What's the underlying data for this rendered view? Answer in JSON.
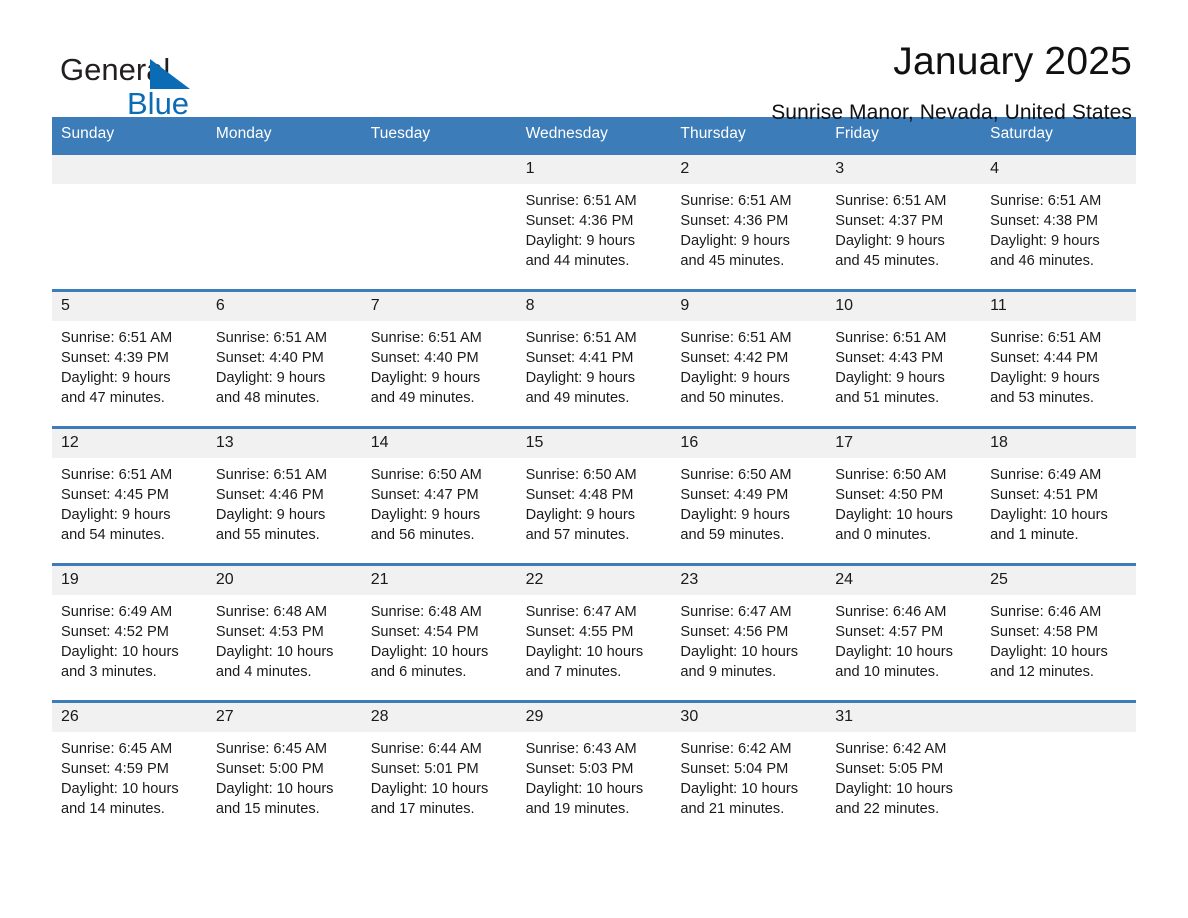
{
  "logo": {
    "word_one": "General",
    "word_two": "Blue",
    "triangle_color": "#0b6cb5",
    "text_color": "#231f20"
  },
  "header": {
    "month_title": "January 2025",
    "location": "Sunrise Manor, Nevada, United States"
  },
  "theme": {
    "header_blue": "#3c7cb8",
    "row_divider_blue": "#3c7cb8",
    "daynum_band": "#f1f1f1",
    "page_background": "#ffffff",
    "text": "#1a1a1a"
  },
  "calendar": {
    "weekdays": [
      "Sunday",
      "Monday",
      "Tuesday",
      "Wednesday",
      "Thursday",
      "Friday",
      "Saturday"
    ],
    "weeks": [
      [
        {
          "day": "",
          "sunrise": "",
          "sunset": "",
          "daylight_1": "",
          "daylight_2": ""
        },
        {
          "day": "",
          "sunrise": "",
          "sunset": "",
          "daylight_1": "",
          "daylight_2": ""
        },
        {
          "day": "",
          "sunrise": "",
          "sunset": "",
          "daylight_1": "",
          "daylight_2": ""
        },
        {
          "day": "1",
          "sunrise": "Sunrise: 6:51 AM",
          "sunset": "Sunset: 4:36 PM",
          "daylight_1": "Daylight: 9 hours",
          "daylight_2": "and 44 minutes."
        },
        {
          "day": "2",
          "sunrise": "Sunrise: 6:51 AM",
          "sunset": "Sunset: 4:36 PM",
          "daylight_1": "Daylight: 9 hours",
          "daylight_2": "and 45 minutes."
        },
        {
          "day": "3",
          "sunrise": "Sunrise: 6:51 AM",
          "sunset": "Sunset: 4:37 PM",
          "daylight_1": "Daylight: 9 hours",
          "daylight_2": "and 45 minutes."
        },
        {
          "day": "4",
          "sunrise": "Sunrise: 6:51 AM",
          "sunset": "Sunset: 4:38 PM",
          "daylight_1": "Daylight: 9 hours",
          "daylight_2": "and 46 minutes."
        }
      ],
      [
        {
          "day": "5",
          "sunrise": "Sunrise: 6:51 AM",
          "sunset": "Sunset: 4:39 PM",
          "daylight_1": "Daylight: 9 hours",
          "daylight_2": "and 47 minutes."
        },
        {
          "day": "6",
          "sunrise": "Sunrise: 6:51 AM",
          "sunset": "Sunset: 4:40 PM",
          "daylight_1": "Daylight: 9 hours",
          "daylight_2": "and 48 minutes."
        },
        {
          "day": "7",
          "sunrise": "Sunrise: 6:51 AM",
          "sunset": "Sunset: 4:40 PM",
          "daylight_1": "Daylight: 9 hours",
          "daylight_2": "and 49 minutes."
        },
        {
          "day": "8",
          "sunrise": "Sunrise: 6:51 AM",
          "sunset": "Sunset: 4:41 PM",
          "daylight_1": "Daylight: 9 hours",
          "daylight_2": "and 49 minutes."
        },
        {
          "day": "9",
          "sunrise": "Sunrise: 6:51 AM",
          "sunset": "Sunset: 4:42 PM",
          "daylight_1": "Daylight: 9 hours",
          "daylight_2": "and 50 minutes."
        },
        {
          "day": "10",
          "sunrise": "Sunrise: 6:51 AM",
          "sunset": "Sunset: 4:43 PM",
          "daylight_1": "Daylight: 9 hours",
          "daylight_2": "and 51 minutes."
        },
        {
          "day": "11",
          "sunrise": "Sunrise: 6:51 AM",
          "sunset": "Sunset: 4:44 PM",
          "daylight_1": "Daylight: 9 hours",
          "daylight_2": "and 53 minutes."
        }
      ],
      [
        {
          "day": "12",
          "sunrise": "Sunrise: 6:51 AM",
          "sunset": "Sunset: 4:45 PM",
          "daylight_1": "Daylight: 9 hours",
          "daylight_2": "and 54 minutes."
        },
        {
          "day": "13",
          "sunrise": "Sunrise: 6:51 AM",
          "sunset": "Sunset: 4:46 PM",
          "daylight_1": "Daylight: 9 hours",
          "daylight_2": "and 55 minutes."
        },
        {
          "day": "14",
          "sunrise": "Sunrise: 6:50 AM",
          "sunset": "Sunset: 4:47 PM",
          "daylight_1": "Daylight: 9 hours",
          "daylight_2": "and 56 minutes."
        },
        {
          "day": "15",
          "sunrise": "Sunrise: 6:50 AM",
          "sunset": "Sunset: 4:48 PM",
          "daylight_1": "Daylight: 9 hours",
          "daylight_2": "and 57 minutes."
        },
        {
          "day": "16",
          "sunrise": "Sunrise: 6:50 AM",
          "sunset": "Sunset: 4:49 PM",
          "daylight_1": "Daylight: 9 hours",
          "daylight_2": "and 59 minutes."
        },
        {
          "day": "17",
          "sunrise": "Sunrise: 6:50 AM",
          "sunset": "Sunset: 4:50 PM",
          "daylight_1": "Daylight: 10 hours",
          "daylight_2": "and 0 minutes."
        },
        {
          "day": "18",
          "sunrise": "Sunrise: 6:49 AM",
          "sunset": "Sunset: 4:51 PM",
          "daylight_1": "Daylight: 10 hours",
          "daylight_2": "and 1 minute."
        }
      ],
      [
        {
          "day": "19",
          "sunrise": "Sunrise: 6:49 AM",
          "sunset": "Sunset: 4:52 PM",
          "daylight_1": "Daylight: 10 hours",
          "daylight_2": "and 3 minutes."
        },
        {
          "day": "20",
          "sunrise": "Sunrise: 6:48 AM",
          "sunset": "Sunset: 4:53 PM",
          "daylight_1": "Daylight: 10 hours",
          "daylight_2": "and 4 minutes."
        },
        {
          "day": "21",
          "sunrise": "Sunrise: 6:48 AM",
          "sunset": "Sunset: 4:54 PM",
          "daylight_1": "Daylight: 10 hours",
          "daylight_2": "and 6 minutes."
        },
        {
          "day": "22",
          "sunrise": "Sunrise: 6:47 AM",
          "sunset": "Sunset: 4:55 PM",
          "daylight_1": "Daylight: 10 hours",
          "daylight_2": "and 7 minutes."
        },
        {
          "day": "23",
          "sunrise": "Sunrise: 6:47 AM",
          "sunset": "Sunset: 4:56 PM",
          "daylight_1": "Daylight: 10 hours",
          "daylight_2": "and 9 minutes."
        },
        {
          "day": "24",
          "sunrise": "Sunrise: 6:46 AM",
          "sunset": "Sunset: 4:57 PM",
          "daylight_1": "Daylight: 10 hours",
          "daylight_2": "and 10 minutes."
        },
        {
          "day": "25",
          "sunrise": "Sunrise: 6:46 AM",
          "sunset": "Sunset: 4:58 PM",
          "daylight_1": "Daylight: 10 hours",
          "daylight_2": "and 12 minutes."
        }
      ],
      [
        {
          "day": "26",
          "sunrise": "Sunrise: 6:45 AM",
          "sunset": "Sunset: 4:59 PM",
          "daylight_1": "Daylight: 10 hours",
          "daylight_2": "and 14 minutes."
        },
        {
          "day": "27",
          "sunrise": "Sunrise: 6:45 AM",
          "sunset": "Sunset: 5:00 PM",
          "daylight_1": "Daylight: 10 hours",
          "daylight_2": "and 15 minutes."
        },
        {
          "day": "28",
          "sunrise": "Sunrise: 6:44 AM",
          "sunset": "Sunset: 5:01 PM",
          "daylight_1": "Daylight: 10 hours",
          "daylight_2": "and 17 minutes."
        },
        {
          "day": "29",
          "sunrise": "Sunrise: 6:43 AM",
          "sunset": "Sunset: 5:03 PM",
          "daylight_1": "Daylight: 10 hours",
          "daylight_2": "and 19 minutes."
        },
        {
          "day": "30",
          "sunrise": "Sunrise: 6:42 AM",
          "sunset": "Sunset: 5:04 PM",
          "daylight_1": "Daylight: 10 hours",
          "daylight_2": "and 21 minutes."
        },
        {
          "day": "31",
          "sunrise": "Sunrise: 6:42 AM",
          "sunset": "Sunset: 5:05 PM",
          "daylight_1": "Daylight: 10 hours",
          "daylight_2": "and 22 minutes."
        },
        {
          "day": "",
          "sunrise": "",
          "sunset": "",
          "daylight_1": "",
          "daylight_2": ""
        }
      ]
    ]
  }
}
